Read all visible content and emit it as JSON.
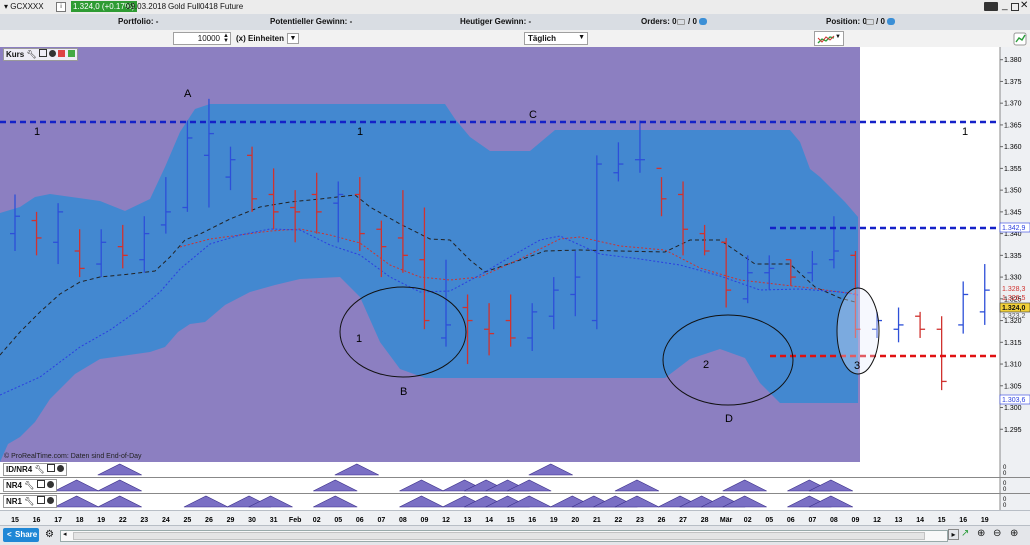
{
  "header": {
    "instrument": "GCXXXX",
    "price_badge": "1.324,0 (+0.17%)",
    "date": "09.03.2018",
    "instrument_name": "Gold Full0418 Future"
  },
  "portfolio_bar": {
    "portfolio": "Portfolio: -",
    "potential_gain": "Potentieller Gewinn: -",
    "today_gain": "Heutiger Gewinn: -",
    "orders_prefix": "Orders: 0",
    "orders_suffix": "/ 0",
    "position_prefix": "Position: 0",
    "position_suffix": "/ 0"
  },
  "toolbar": {
    "quantity": "10000",
    "units": "(x) Einheiten",
    "period": "Täglich"
  },
  "chart_panel": {
    "title": "Kurs",
    "footer": "© ProRealTime.com: Daten sind End-of-Day"
  },
  "indicators": [
    {
      "label": "ID/NR4"
    },
    {
      "label": "NR4"
    },
    {
      "label": "NR1"
    }
  ],
  "annotations": {
    "A": "A",
    "B": "B",
    "C": "C",
    "D": "D",
    "one_a": "1",
    "one_b": "1",
    "one_c": "1",
    "circle1": "1",
    "circle2": "2",
    "circle3": "3"
  },
  "price_labels": {
    "blue_top": "1.342,9",
    "red1": "1.328,3",
    "red2": "1.326,5",
    "current": "1.324,0",
    "small": "1.323,2",
    "blue_bottom": "1.303,6"
  },
  "bottom": {
    "share": "Share"
  },
  "colors": {
    "bg_purple": "#8c7fc1",
    "band_blue": "#3d89d1",
    "up_bar": "#2d4fd8",
    "down_bar": "#d0322f",
    "future_bg": "#ffffff",
    "blue_level": "#1421c8",
    "red_level": "#e01010",
    "price_badge": "#2e9b33"
  },
  "chart_data": {
    "type": "candlestick (OHLC bars)",
    "title": "Kurs",
    "ylim": [
      1.29,
      1.382
    ],
    "y_ticks": [
      "1.380",
      "1.375",
      "1.370",
      "1.365",
      "1.360",
      "1.355",
      "1.350",
      "1.345",
      "1.340",
      "1.335",
      "1.330",
      "1.325",
      "1.320",
      "1.315",
      "1.310",
      "1.305",
      "1.300",
      "1.295"
    ],
    "x_ticks": [
      "15",
      "16",
      "17",
      "18",
      "19",
      "22",
      "23",
      "24",
      "25",
      "26",
      "29",
      "30",
      "31",
      "Feb",
      "02",
      "05",
      "06",
      "07",
      "08",
      "09",
      "12",
      "13",
      "14",
      "15",
      "16",
      "19",
      "20",
      "21",
      "22",
      "23",
      "26",
      "27",
      "28",
      "Mär",
      "02",
      "05",
      "06",
      "07",
      "08",
      "09",
      "12",
      "13",
      "14",
      "15",
      "16",
      "19"
    ],
    "bars": [
      {
        "o": 1.34,
        "h": 1.349,
        "l": 1.336,
        "c": 1.344
      },
      {
        "o": 1.343,
        "h": 1.345,
        "l": 1.335,
        "c": 1.339
      },
      {
        "o": 1.338,
        "h": 1.347,
        "l": 1.333,
        "c": 1.345
      },
      {
        "o": 1.336,
        "h": 1.341,
        "l": 1.33,
        "c": 1.332
      },
      {
        "o": 1.333,
        "h": 1.341,
        "l": 1.33,
        "c": 1.338
      },
      {
        "o": 1.337,
        "h": 1.342,
        "l": 1.332,
        "c": 1.335
      },
      {
        "o": 1.334,
        "h": 1.344,
        "l": 1.331,
        "c": 1.34
      },
      {
        "o": 1.342,
        "h": 1.353,
        "l": 1.34,
        "c": 1.345
      },
      {
        "o": 1.346,
        "h": 1.366,
        "l": 1.345,
        "c": 1.362
      },
      {
        "o": 1.358,
        "h": 1.371,
        "l": 1.346,
        "c": 1.363
      },
      {
        "o": 1.353,
        "h": 1.36,
        "l": 1.35,
        "c": 1.357
      },
      {
        "o": 1.358,
        "h": 1.36,
        "l": 1.345,
        "c": 1.348
      },
      {
        "o": 1.349,
        "h": 1.355,
        "l": 1.341,
        "c": 1.345
      },
      {
        "o": 1.346,
        "h": 1.35,
        "l": 1.338,
        "c": 1.345
      },
      {
        "o": 1.349,
        "h": 1.354,
        "l": 1.34,
        "c": 1.345
      },
      {
        "o": 1.347,
        "h": 1.352,
        "l": 1.338,
        "c": 1.349
      },
      {
        "o": 1.349,
        "h": 1.353,
        "l": 1.336,
        "c": 1.34
      },
      {
        "o": 1.341,
        "h": 1.343,
        "l": 1.33,
        "c": 1.337
      },
      {
        "o": 1.339,
        "h": 1.35,
        "l": 1.331,
        "c": 1.335
      },
      {
        "o": 1.334,
        "h": 1.346,
        "l": 1.318,
        "c": 1.32
      },
      {
        "o": 1.316,
        "h": 1.334,
        "l": 1.314,
        "c": 1.319
      },
      {
        "o": 1.323,
        "h": 1.326,
        "l": 1.31,
        "c": 1.32
      },
      {
        "o": 1.318,
        "h": 1.324,
        "l": 1.312,
        "c": 1.317
      },
      {
        "o": 1.32,
        "h": 1.326,
        "l": 1.314,
        "c": 1.316
      },
      {
        "o": 1.316,
        "h": 1.324,
        "l": 1.313,
        "c": 1.322
      },
      {
        "o": 1.321,
        "h": 1.33,
        "l": 1.318,
        "c": 1.327
      },
      {
        "o": 1.326,
        "h": 1.336,
        "l": 1.321,
        "c": 1.33
      },
      {
        "o": 1.32,
        "h": 1.358,
        "l": 1.318,
        "c": 1.356
      },
      {
        "o": 1.354,
        "h": 1.361,
        "l": 1.352,
        "c": 1.356
      },
      {
        "o": 1.357,
        "h": 1.366,
        "l": 1.354,
        "c": 1.357
      },
      {
        "o": 1.355,
        "h": 1.353,
        "l": 1.344,
        "c": 1.348
      },
      {
        "o": 1.349,
        "h": 1.352,
        "l": 1.335,
        "c": 1.341
      },
      {
        "o": 1.34,
        "h": 1.342,
        "l": 1.335,
        "c": 1.336
      },
      {
        "o": 1.338,
        "h": 1.339,
        "l": 1.323,
        "c": 1.327
      },
      {
        "o": 1.325,
        "h": 1.335,
        "l": 1.324,
        "c": 1.331
      },
      {
        "o": 1.331,
        "h": 1.335,
        "l": 1.327,
        "c": 1.332
      },
      {
        "o": 1.334,
        "h": 1.334,
        "l": 1.328,
        "c": 1.33
      },
      {
        "o": 1.331,
        "h": 1.336,
        "l": 1.329,
        "c": 1.333
      },
      {
        "o": 1.334,
        "h": 1.344,
        "l": 1.332,
        "c": 1.336
      },
      {
        "o": 1.335,
        "h": 1.336,
        "l": 1.316,
        "c": 1.318
      },
      {
        "o": 1.318,
        "h": 1.322,
        "l": 1.316,
        "c": 1.32
      },
      {
        "o": 1.318,
        "h": 1.323,
        "l": 1.315,
        "c": 1.319
      },
      {
        "o": 1.321,
        "h": 1.322,
        "l": 1.316,
        "c": 1.318
      },
      {
        "o": 1.318,
        "h": 1.321,
        "l": 1.304,
        "c": 1.306
      },
      {
        "o": 1.319,
        "h": 1.329,
        "l": 1.317,
        "c": 1.326
      },
      {
        "o": 1.322,
        "h": 1.333,
        "l": 1.319,
        "c": 1.327
      },
      {
        "o": 1.329,
        "h": 1.34,
        "l": 1.322,
        "c": 1.336
      },
      {
        "o": 1.34,
        "h": 1.34,
        "l": 1.323,
        "c": 1.327
      },
      {
        "o": 1.326,
        "h": 1.33,
        "l": 1.322,
        "c": 1.325
      },
      {
        "o": 1.324,
        "h": 1.328,
        "l": 1.313,
        "c": 1.324
      }
    ]
  }
}
